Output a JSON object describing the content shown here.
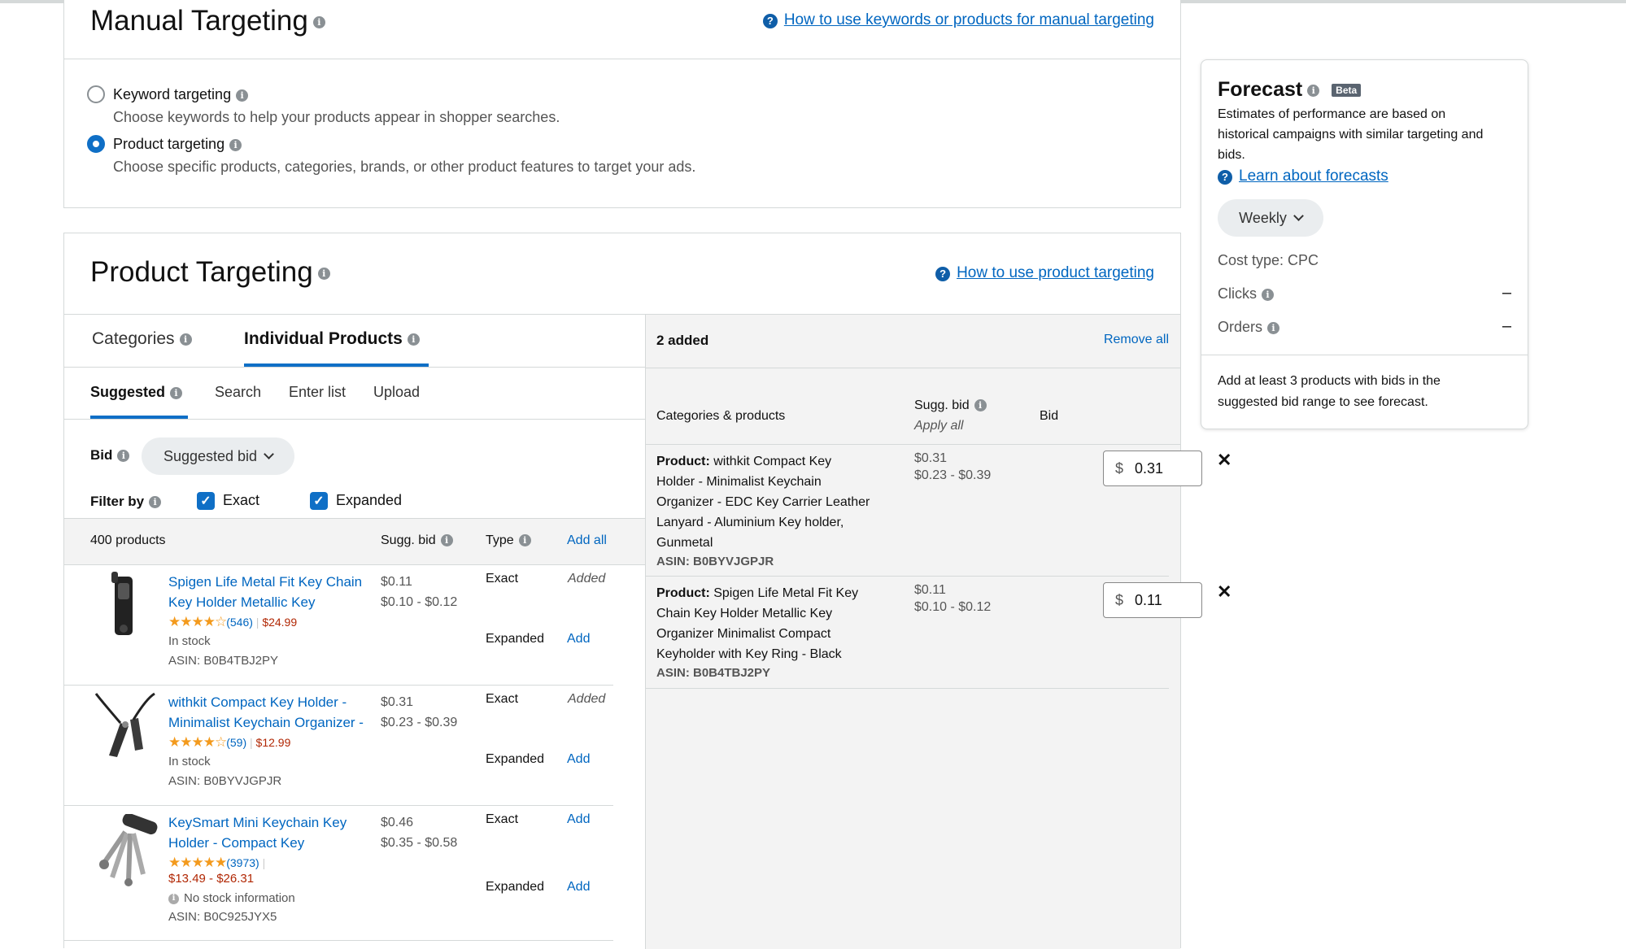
{
  "manual": {
    "title": "Manual Targeting",
    "help_link": "How to use keywords or products for manual targeting",
    "options": [
      {
        "label": "Keyword targeting",
        "desc": "Choose keywords to help your products appear in shopper searches.",
        "selected": false
      },
      {
        "label": "Product targeting",
        "desc": "Choose specific products, categories, brands, or other product features to target your ads.",
        "selected": true
      }
    ]
  },
  "product_targeting": {
    "title": "Product Targeting",
    "help_link": "How to use product targeting",
    "tabs": [
      "Categories",
      "Individual Products"
    ],
    "active_tab": "Individual Products",
    "subtabs": [
      "Suggested",
      "Search",
      "Enter list",
      "Upload"
    ],
    "active_subtab": "Suggested",
    "bid_label": "Bid",
    "bid_select": "Suggested bid",
    "filter_label": "Filter by",
    "filters": [
      "Exact",
      "Expanded"
    ],
    "list_header": {
      "count": "400 products",
      "sugg_bid": "Sugg. bid",
      "type": "Type",
      "add_all": "Add all"
    },
    "products": [
      {
        "title_line1": "Spigen Life Metal Fit Key Chain",
        "title_line2": "Key Holder Metallic Key",
        "stars": "★★★★☆",
        "reviews": "(546)",
        "price": "$24.99",
        "stock": "In stock",
        "asin": "ASIN: B0B4TBJ2PY",
        "bid": "$0.11",
        "range": "$0.10 - $0.12",
        "type1": "Exact",
        "action1": "Added",
        "type2": "Expanded",
        "action2": "Add"
      },
      {
        "title_line1": "withkit Compact Key Holder -",
        "title_line2": "Minimalist Keychain Organizer -",
        "stars": "★★★★☆",
        "reviews": "(59)",
        "price": "$12.99",
        "stock": "In stock",
        "asin": "ASIN: B0BYVJGPJR",
        "bid": "$0.31",
        "range": "$0.23 - $0.39",
        "type1": "Exact",
        "action1": "Added",
        "type2": "Expanded",
        "action2": "Add"
      },
      {
        "title_line1": "KeySmart Mini Keychain Key",
        "title_line2": "Holder - Compact Key",
        "stars": "★★★★★",
        "reviews": "(3973)",
        "price": "$13.49 - $26.31",
        "stock": "No stock information",
        "asin": "ASIN: B0C925JYX5",
        "bid": "$0.46",
        "range": "$0.35 - $0.58",
        "type1": "Exact",
        "action1": "Add",
        "type2": "Expanded",
        "action2": "Add"
      }
    ],
    "added": {
      "count": "2 added",
      "remove_all": "Remove all",
      "col_products": "Categories & products",
      "col_sugg": "Sugg. bid",
      "apply_all": "Apply all",
      "col_bid": "Bid",
      "items": [
        {
          "prefix": "Product:",
          "lines": [
            "withkit Compact Key",
            "Holder - Minimalist Keychain",
            "Organizer - EDC Key Carrier Leather",
            "Lanyard - Aluminium Key holder,",
            "Gunmetal"
          ],
          "asin": "ASIN: B0BYVJGPJR",
          "bid": "$0.31",
          "range": "$0.23 - $0.39",
          "currency": "$",
          "value": "0.31"
        },
        {
          "prefix": "Product:",
          "lines": [
            "Spigen Life Metal Fit Key",
            "Chain Key Holder Metallic Key",
            "Organizer Minimalist Compact",
            "Keyholder with Key Ring - Black"
          ],
          "asin": "ASIN: B0B4TBJ2PY",
          "bid": "$0.11",
          "range": "$0.10 - $0.12",
          "currency": "$",
          "value": "0.11"
        }
      ]
    }
  },
  "forecast": {
    "title": "Forecast",
    "badge": "Beta",
    "desc_lines": [
      "Estimates of performance are based on",
      "historical campaigns with similar targeting and",
      "bids."
    ],
    "learn_link": "Learn about forecasts",
    "period": "Weekly",
    "cost_type": "Cost type: CPC",
    "metrics": [
      {
        "label": "Clicks",
        "value": "–"
      },
      {
        "label": "Orders",
        "value": "–"
      }
    ],
    "note_lines": [
      "Add at least 3 products with bids in the",
      "suggested bid range to see forecast."
    ]
  }
}
